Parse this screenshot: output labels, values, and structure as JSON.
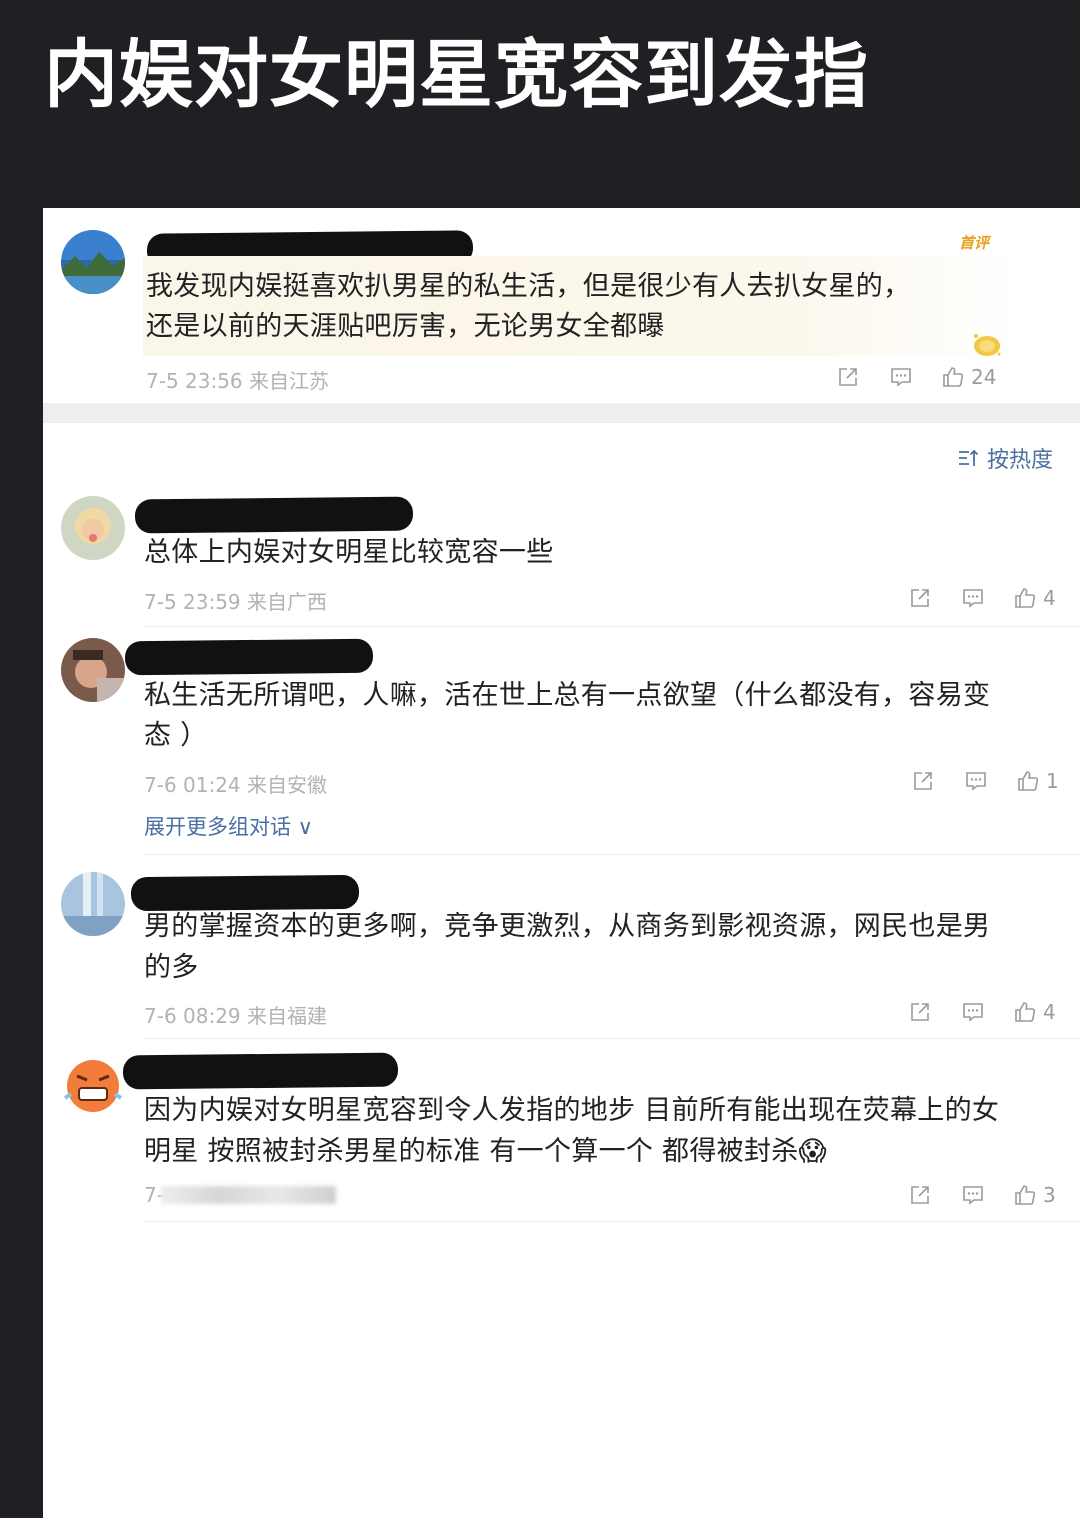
{
  "headline": "内娱对女明星宽容到发指",
  "top_comment": {
    "badge": "首评",
    "text_line1": "我发现内娱挺喜欢扒男星的私生活，但是很少有人去扒女星的，",
    "text_line2": "还是以前的天涯贴吧厉害，无论男女全都曝",
    "meta": "7-5 23:56 来自江苏",
    "likes": "24"
  },
  "sort_label": "按热度",
  "replies": [
    {
      "line1": "总体上内娱对女明星比较宽容一些",
      "line2": "",
      "meta": "7-5 23:59 来自广西",
      "likes": "4",
      "more": ""
    },
    {
      "line1": "私生活无所谓吧，人嘛，活在世上总有一点欲望（什么都没有，容易变",
      "line2": "态 ）",
      "meta": "7-6 01:24 来自安徽",
      "likes": "1",
      "more": "展开更多组对话 ∨"
    },
    {
      "line1": "男的掌握资本的更多啊，竞争更激烈，从商务到影视资源，网民也是男",
      "line2": "的多",
      "meta": "7-6 08:29 来自福建",
      "likes": "4",
      "more": ""
    },
    {
      "line1": "因为内娱对女明星宽容到令人发指的地步 目前所有能出现在荧幕上的女",
      "line2": "明星 按照被封杀男星的标准 有一个算一个  都得被封杀😱",
      "meta": "7-",
      "likes": "3",
      "more": ""
    }
  ],
  "icons": {
    "share": "share-icon",
    "comment": "comment-icon",
    "like": "like-icon",
    "sort": "sort-icon"
  },
  "colors": {
    "link": "#4a6ea5",
    "badge": "#e6a21a",
    "meta": "#b2b2b2"
  }
}
